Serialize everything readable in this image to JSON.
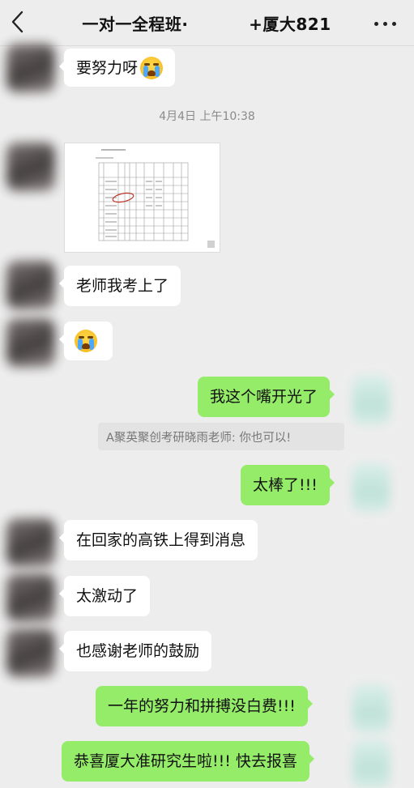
{
  "header": {
    "title": "一对一全程班·          +厦大821"
  },
  "timestamp": "4月4日 上午10:38",
  "messages": {
    "m1": "要努力呀",
    "m2": "老师我考上了",
    "m4": "我这个嘴开光了",
    "quote": "A聚英聚创考研晓雨老师: 你也可以!",
    "m5": "太棒了!!!",
    "m6": "在回家的高铁上得到消息",
    "m7": "太激动了",
    "m8": "也感谢老师的鼓励",
    "m9": "一年的努力和拼搏没白费!!!",
    "m10": "恭喜厦大准研究生啦!!! 快去报喜"
  },
  "icons": {
    "back": "chevron-left-icon",
    "more": "more-horizontal-icon",
    "emoji": "loudly-crying-face-emoji"
  },
  "colors": {
    "background": "#ededed",
    "incoming_bubble": "#ffffff",
    "outgoing_bubble": "#95ec69"
  }
}
